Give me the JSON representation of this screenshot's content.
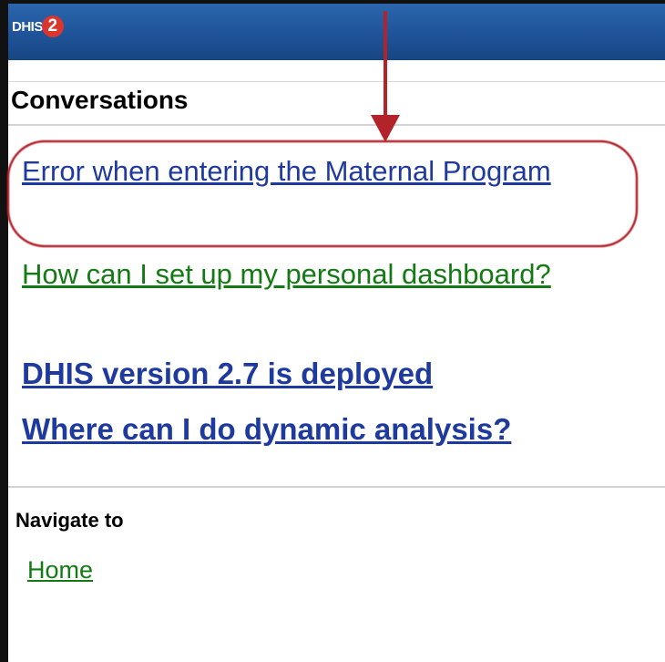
{
  "header": {
    "logo_text": "DHIS",
    "logo_badge": "2",
    "background_color": "#1f5399"
  },
  "conversations": {
    "title": "Conversations",
    "items": [
      {
        "label": "Error when entering the Maternal Program",
        "style": "regular",
        "color": "#1f3a9e",
        "highlighted": true
      },
      {
        "label": "How can I set up my personal dashboard?",
        "style": "regular",
        "color": "#137a14",
        "highlighted": false
      },
      {
        "label": "DHIS version 2.7 is deployed",
        "style": "bold",
        "color": "#1f3a9e",
        "highlighted": false
      },
      {
        "label": "Where can I do dynamic analysis?",
        "style": "bold",
        "color": "#1f3a9e",
        "highlighted": false
      }
    ]
  },
  "navigate": {
    "title": "Navigate to",
    "home_label": "Home"
  },
  "annotation": {
    "arrow_color": "#b3242a",
    "highlight_color": "#b3242a"
  }
}
